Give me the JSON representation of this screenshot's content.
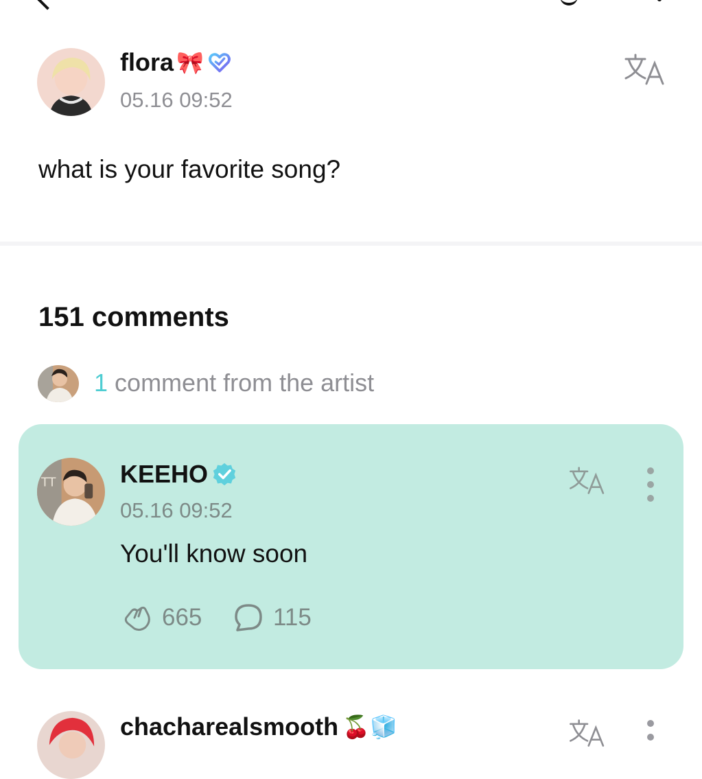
{
  "post": {
    "author": "flora",
    "author_emoji": "🎀",
    "timestamp": "05.16 09:52",
    "text": "what is your favorite song?"
  },
  "comments": {
    "count_label": "151 comments",
    "artist_count": "1",
    "artist_label": "comment from the artist"
  },
  "artist_comment": {
    "author": "KEEHO",
    "timestamp": "05.16 09:52",
    "text": "You'll know soon",
    "likes": "665",
    "replies": "115"
  },
  "next_comment": {
    "author": "chacharealsmooth",
    "author_emoji": "🍒🧊"
  },
  "colors": {
    "accent": "#4ecdd2",
    "card_bg": "#c2ebe1",
    "muted_text": "#8e8e93"
  }
}
